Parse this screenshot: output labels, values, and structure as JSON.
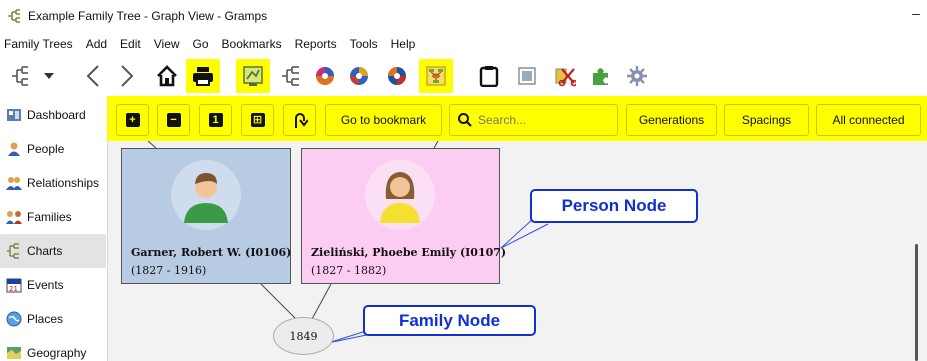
{
  "window": {
    "title": "Example Family Tree - Graph View - Gramps",
    "minimize_glyph": "–"
  },
  "menu": [
    "Family Trees",
    "Add",
    "Edit",
    "View",
    "Go",
    "Bookmarks",
    "Reports",
    "Tools",
    "Help"
  ],
  "sidebar": {
    "items": [
      {
        "label": "Dashboard",
        "icon": "dashboard-icon"
      },
      {
        "label": "People",
        "icon": "person-icon"
      },
      {
        "label": "Relationships",
        "icon": "relationships-icon"
      },
      {
        "label": "Families",
        "icon": "families-icon"
      },
      {
        "label": "Charts",
        "icon": "charts-icon",
        "active": true
      },
      {
        "label": "Events",
        "icon": "events-icon"
      },
      {
        "label": "Places",
        "icon": "places-icon"
      },
      {
        "label": "Geography",
        "icon": "geography-icon"
      }
    ]
  },
  "graph_toolbar": {
    "plus": "+",
    "minus": "−",
    "one": "1",
    "fit": "⊞",
    "goto_bookmark": "Go to bookmark",
    "search_placeholder": "Search...",
    "generations": "Generations",
    "spacings": "Spacings",
    "all_connected": "All connected"
  },
  "graph": {
    "person1": {
      "name": "Garner, Robert W. (I0106)",
      "dates": "(1827 - 1916)",
      "color": "#b7cbe3"
    },
    "person2": {
      "name": "Zieliński, Phoebe Emily (I0107)",
      "dates": "(1827 - 1882)",
      "color": "#fdccf2"
    },
    "family": {
      "label": "1849"
    },
    "callout_person": "Person Node",
    "callout_family": "Family Node"
  },
  "colors": {
    "highlight": "#ffff00",
    "callout": "#1030d0"
  }
}
